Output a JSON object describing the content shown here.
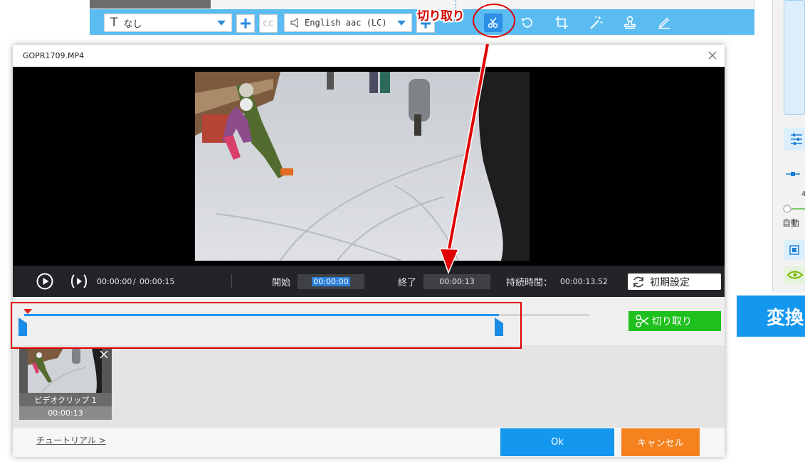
{
  "toolbar": {
    "subtitle_select": "なし",
    "subtitle_prefix_glyph": "T",
    "cc_label": "cc",
    "audio_select": "English aac (LC)"
  },
  "annotation": {
    "label": "切り取り"
  },
  "right_panel": {
    "auto_label": "自動",
    "value_fragment": "4",
    "convert_label": "変換"
  },
  "dialog": {
    "title": "GOPR1709.MP4",
    "controls": {
      "current_time": "00:00:00",
      "separator": "/",
      "total_time": "00:00:15",
      "start_label": "開始",
      "start_value": "00:00:00",
      "end_label": "終了",
      "end_value": "00:00:13",
      "duration_label": "持続時間：",
      "duration_value": "00:00:13.52",
      "reset_label": "初期設定"
    },
    "trim": {
      "cut_label": "切り取り",
      "start_fraction": 0.0,
      "end_fraction": 0.84
    },
    "clip": {
      "name": "ビデオクリップ 1",
      "duration": "00:00:13"
    },
    "footer": {
      "tutorial_link": "チュートリアル >",
      "ok_label": "Ok",
      "cancel_label": "キャンセル"
    }
  },
  "colors": {
    "toolbar_blue": "#5bbcf2",
    "accent_blue": "#1497ef",
    "cut_green": "#1ec01e",
    "cancel_orange": "#f5821f",
    "annotation_red": "#e00000"
  }
}
